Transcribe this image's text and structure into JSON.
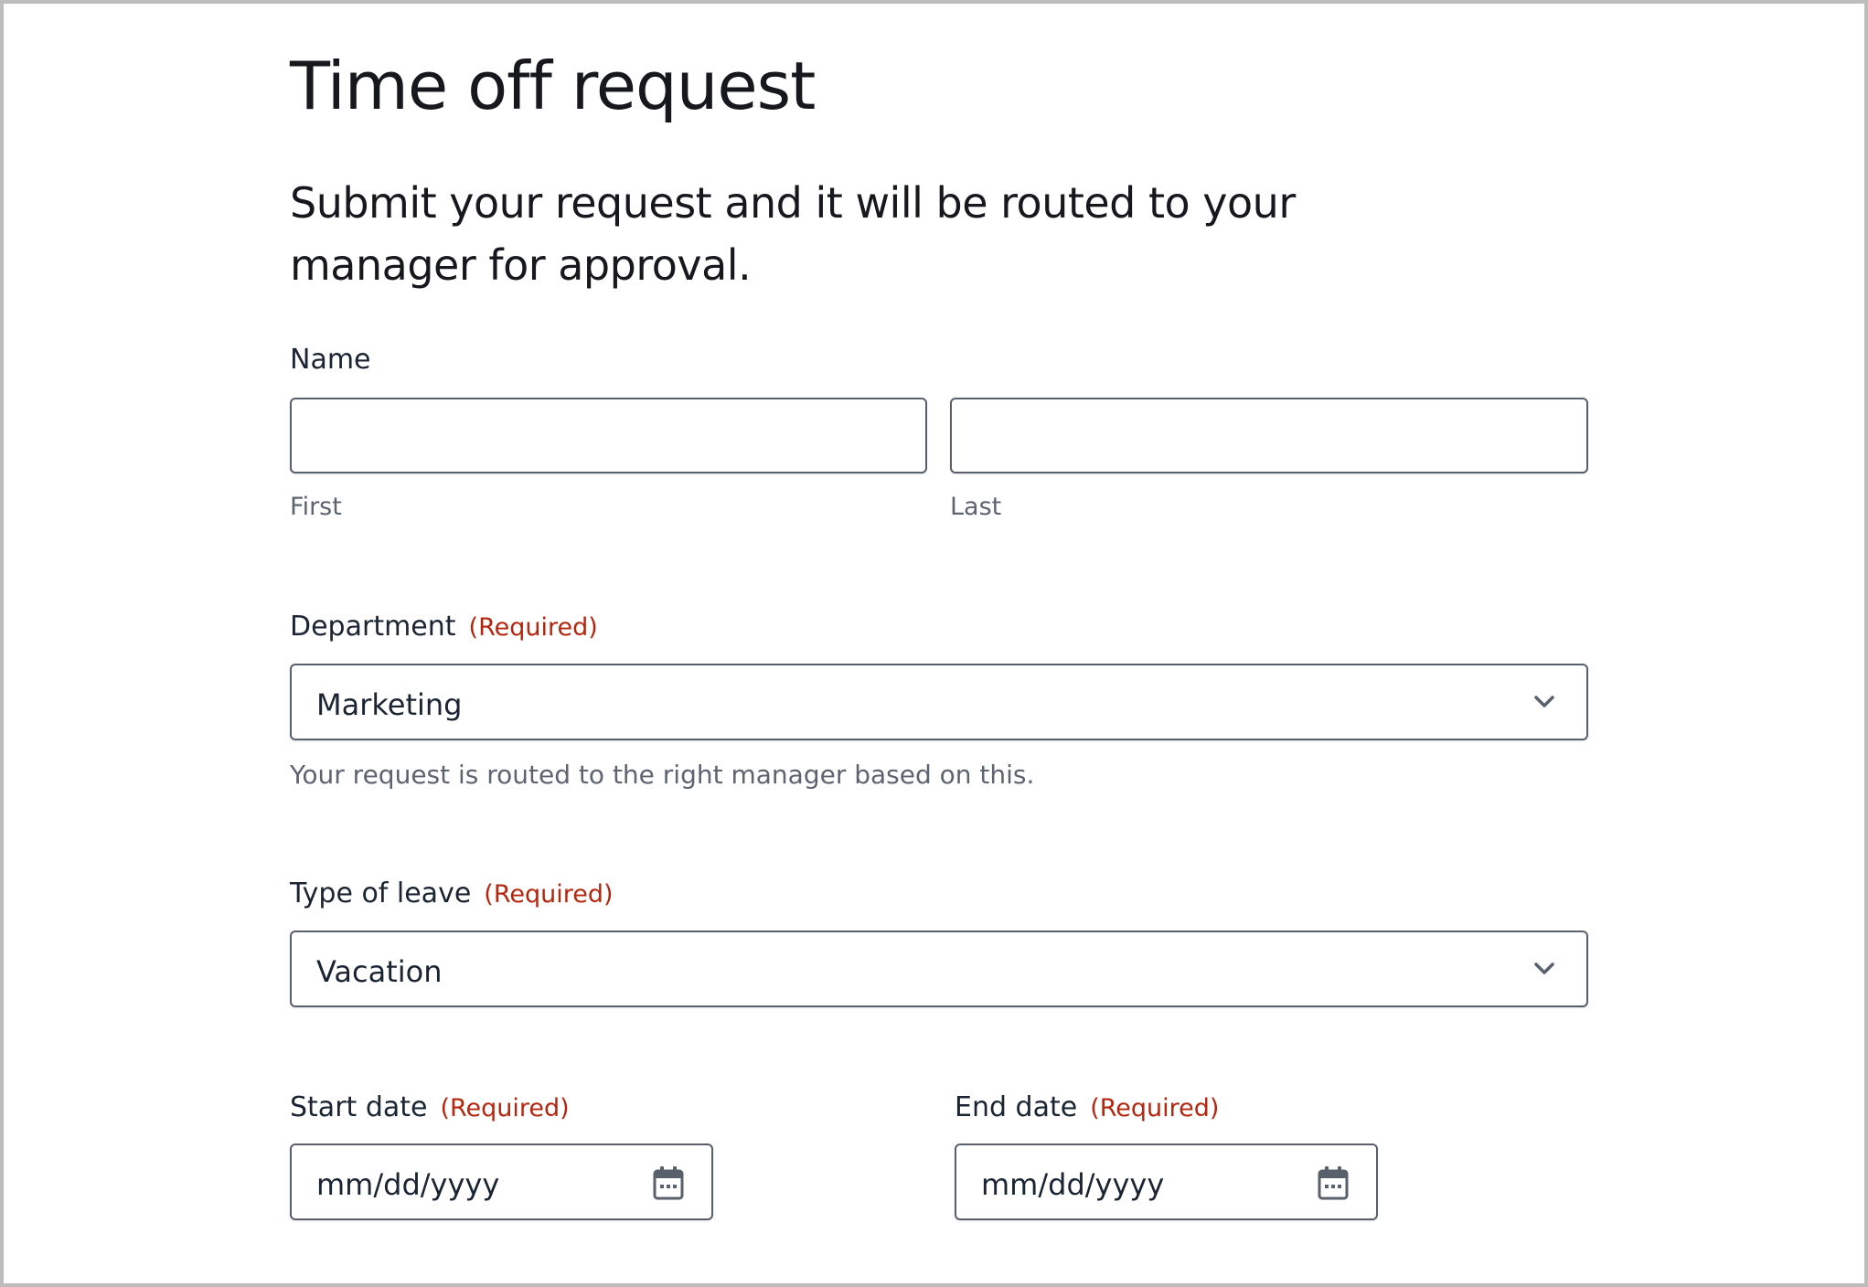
{
  "form": {
    "title": "Time off request",
    "subtitle": "Submit your request and it will be routed to your manager for approval.",
    "required_text": "(Required)",
    "name": {
      "label": "Name",
      "first_value": "",
      "last_value": "",
      "first_sublabel": "First",
      "last_sublabel": "Last"
    },
    "department": {
      "label": "Department",
      "value": "Marketing",
      "hint": "Your request is routed to the right manager based on this."
    },
    "leave_type": {
      "label": "Type of leave",
      "value": "Vacation"
    },
    "start_date": {
      "label": "Start date",
      "placeholder": "mm/dd/yyyy"
    },
    "end_date": {
      "label": "End date",
      "placeholder": "mm/dd/yyyy"
    }
  },
  "colors": {
    "required": "#b5260f",
    "text": "#1a2433",
    "muted": "#5d6470",
    "border": "#58606c"
  },
  "icons": {
    "select": "chevron-down-icon",
    "date": "calendar-icon"
  }
}
